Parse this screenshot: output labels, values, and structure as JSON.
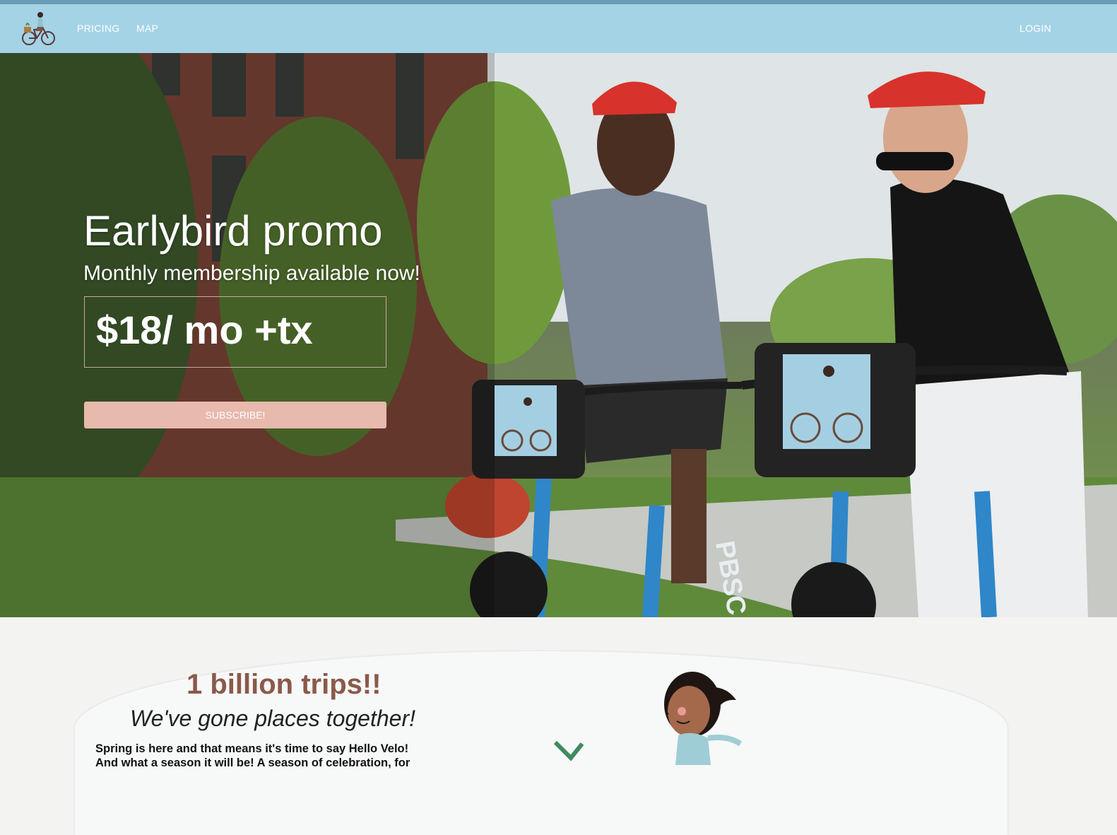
{
  "nav": {
    "links": [
      "PRICING",
      "MAP"
    ],
    "login": "LOGIN"
  },
  "hero": {
    "title": "Earlybird promo",
    "subtitle": "Monthly membership available now!",
    "price": "$18/ mo +tx",
    "cta": "SUBSCRIBE!",
    "bike_plate": "PBSC"
  },
  "section": {
    "title": "1 billion trips!!",
    "subtitle": "We've gone places together!",
    "body_lines": [
      "Spring is here and that means it's time to say Hello Velo!",
      "And what a season it will be! A season of celebration, for"
    ]
  },
  "colors": {
    "navbar": "#a4d3e6",
    "accent_button": "#e8b9ad",
    "section_title": "#8a5a4a"
  }
}
